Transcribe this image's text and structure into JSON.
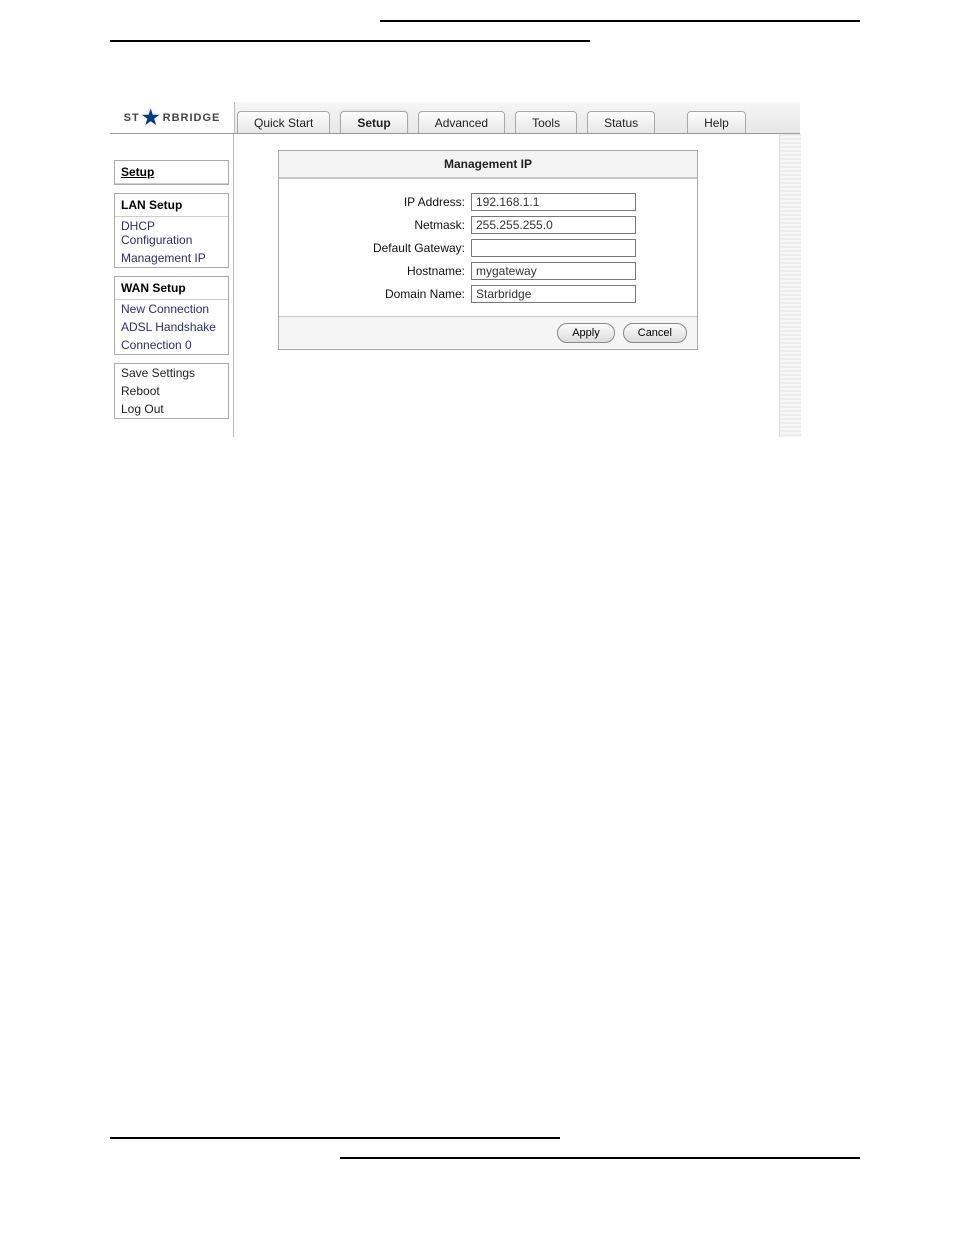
{
  "logo": {
    "prefix": "ST",
    "suffix": "RBRIDGE"
  },
  "tabs": [
    "Quick Start",
    "Setup",
    "Advanced",
    "Tools",
    "Status",
    "Help"
  ],
  "sidebar": {
    "heading": "Setup",
    "lan": {
      "heading": "LAN Setup",
      "items": [
        "DHCP Configuration",
        "Management IP"
      ]
    },
    "wan": {
      "heading": "WAN Setup",
      "items": [
        "New Connection",
        "ADSL Handshake",
        "Connection 0"
      ]
    },
    "sys": {
      "items": [
        "Save Settings",
        "Reboot",
        "Log Out"
      ]
    }
  },
  "panel": {
    "title": "Management IP",
    "labels": {
      "ip": "IP Address:",
      "netmask": "Netmask:",
      "gateway": "Default Gateway:",
      "hostname": "Hostname:",
      "domain": "Domain Name:"
    },
    "values": {
      "ip": "192.168.1.1",
      "netmask": "255.255.255.0",
      "gateway": "",
      "hostname": "mygateway",
      "domain": "Starbridge"
    },
    "buttons": {
      "apply": "Apply",
      "cancel": "Cancel"
    }
  }
}
